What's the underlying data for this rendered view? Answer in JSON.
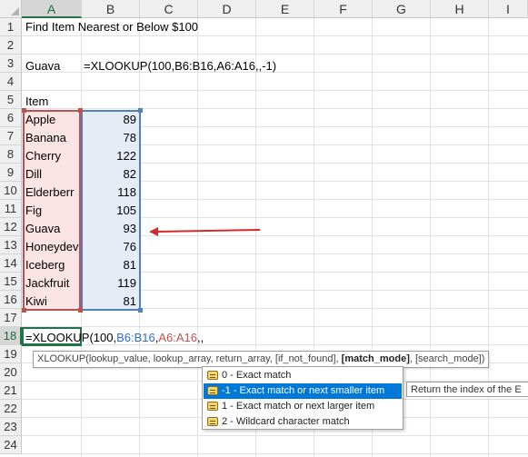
{
  "columns": [
    "A",
    "B",
    "C",
    "D",
    "E",
    "F",
    "G",
    "H",
    "I"
  ],
  "rows": [
    "1",
    "2",
    "3",
    "4",
    "5",
    "6",
    "7",
    "8",
    "9",
    "10",
    "11",
    "12",
    "13",
    "14",
    "15",
    "16",
    "17",
    "18",
    "19",
    "20",
    "21",
    "22",
    "23",
    "24"
  ],
  "cells": {
    "a1": "Find Item Nearest or Below $100",
    "a3": "Guava",
    "b3": "=XLOOKUP(100,B6:B16,A6:A16,,-1)",
    "a5": "Item"
  },
  "items": [
    {
      "name": "Apple",
      "value": "89"
    },
    {
      "name": "Banana",
      "value": "78"
    },
    {
      "name": "Cherry",
      "value": "122"
    },
    {
      "name": "Dill",
      "value": "82"
    },
    {
      "name": "Elderberr",
      "value": "118"
    },
    {
      "name": "Fig",
      "value": "105"
    },
    {
      "name": "Guava",
      "value": "93"
    },
    {
      "name": "Honeydev",
      "value": "76"
    },
    {
      "name": "Iceberg",
      "value": "81"
    },
    {
      "name": "Jackfruit",
      "value": "119"
    },
    {
      "name": "Kiwi",
      "value": "81"
    }
  ],
  "editing": {
    "prefix": "=XLOOKUP(100,",
    "ref1": "B6:B16",
    "sep1": ",",
    "ref2": "A6:A16",
    "suffix": ",,"
  },
  "tooltip": {
    "fn": "XLOOKUP(lookup_value, lookup_array, return_array, [if_not_found], ",
    "current": "[match_mode]",
    "rest": ", [search_mode])"
  },
  "dropdown": [
    "0 - Exact match",
    "-1 - Exact match or next smaller item",
    "1 - Exact match or next larger item",
    "2 - Wildcard character match"
  ],
  "dropdown_selected_index": 1,
  "dropdown_icon": "constant-value-icon",
  "description": "Return the index of the E",
  "colors": {
    "accent": "#217346",
    "range_a": "#c0504d",
    "range_b": "#4f81bd",
    "arrow": "#d42a2a",
    "selection": "#0078d7"
  }
}
